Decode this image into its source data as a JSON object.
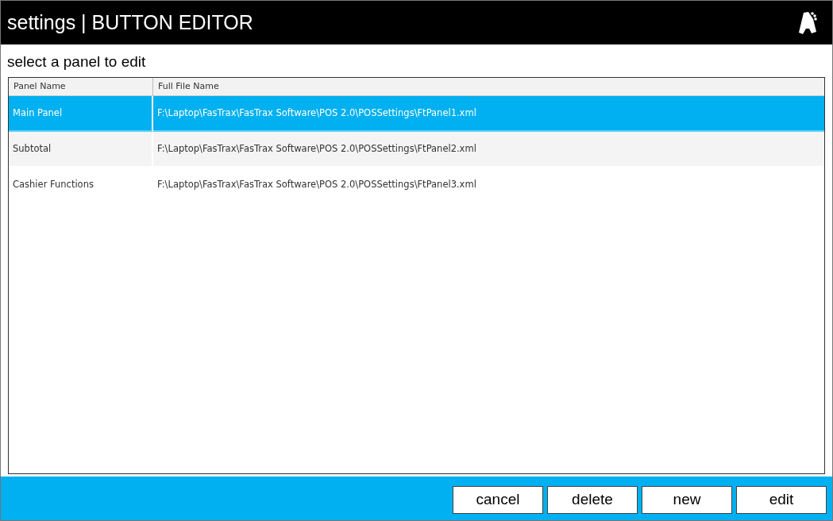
{
  "window": {
    "title": "settings | BUTTON EDITOR"
  },
  "heading": "select a panel to edit",
  "table": {
    "columns": [
      "Panel Name",
      "Full File Name"
    ],
    "rows": [
      {
        "panel_name": "Main Panel",
        "full_file_name": "F:\\Laptop\\FasTrax\\FasTrax Software\\POS 2.0\\POSSettings\\FtPanel1.xml",
        "selected": true
      },
      {
        "panel_name": "Subtotal",
        "full_file_name": "F:\\Laptop\\FasTrax\\FasTrax Software\\POS 2.0\\POSSettings\\FtPanel2.xml",
        "selected": false
      },
      {
        "panel_name": "Cashier Functions",
        "full_file_name": "F:\\Laptop\\FasTrax\\FasTrax Software\\POS 2.0\\POSSettings\\FtPanel3.xml",
        "selected": false
      }
    ]
  },
  "buttons": [
    "cancel",
    "delete",
    "new",
    "edit"
  ]
}
